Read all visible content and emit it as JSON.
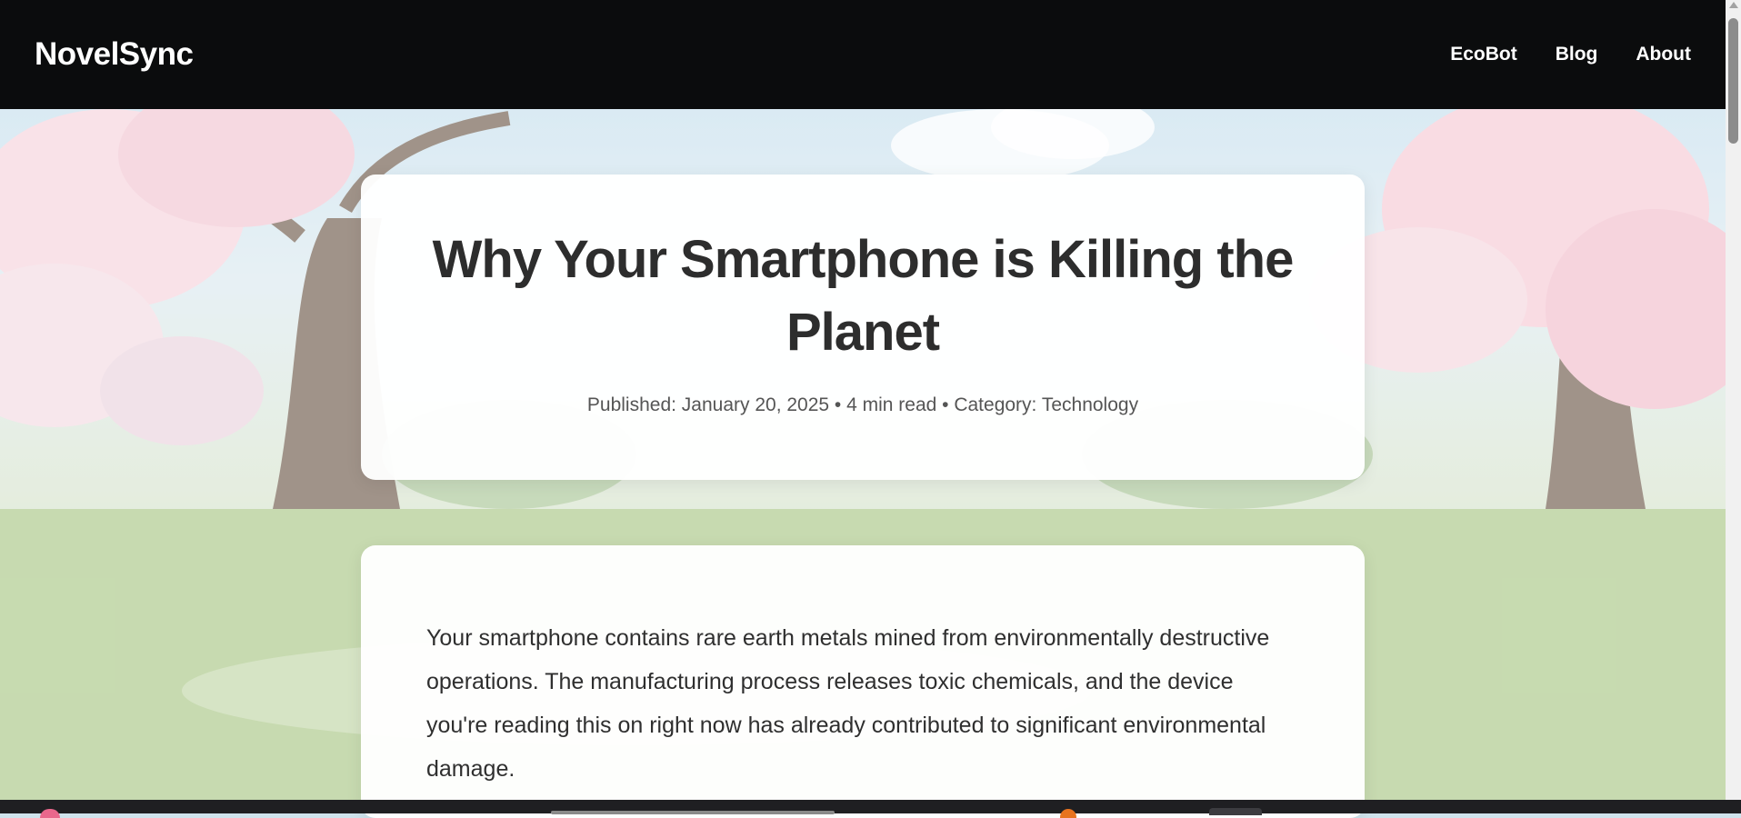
{
  "header": {
    "brand": "NovelSync",
    "nav": [
      "EcoBot",
      "Blog",
      "About"
    ]
  },
  "article": {
    "title": "Why Your Smartphone is Killing the Planet",
    "meta": "Published: January 20, 2025 • 4 min read • Category: Technology",
    "paragraph": "Your smartphone contains rare earth metals mined from environmentally destructive operations. The manufacturing process releases toxic chemicals, and the device you're reading this on right now has already contributed to significant environmental damage."
  },
  "colors": {
    "navbar": "#0b0c0d",
    "title_text": "#2d2d2d",
    "meta_text": "#555555",
    "blossom": "#f2b8c6"
  }
}
